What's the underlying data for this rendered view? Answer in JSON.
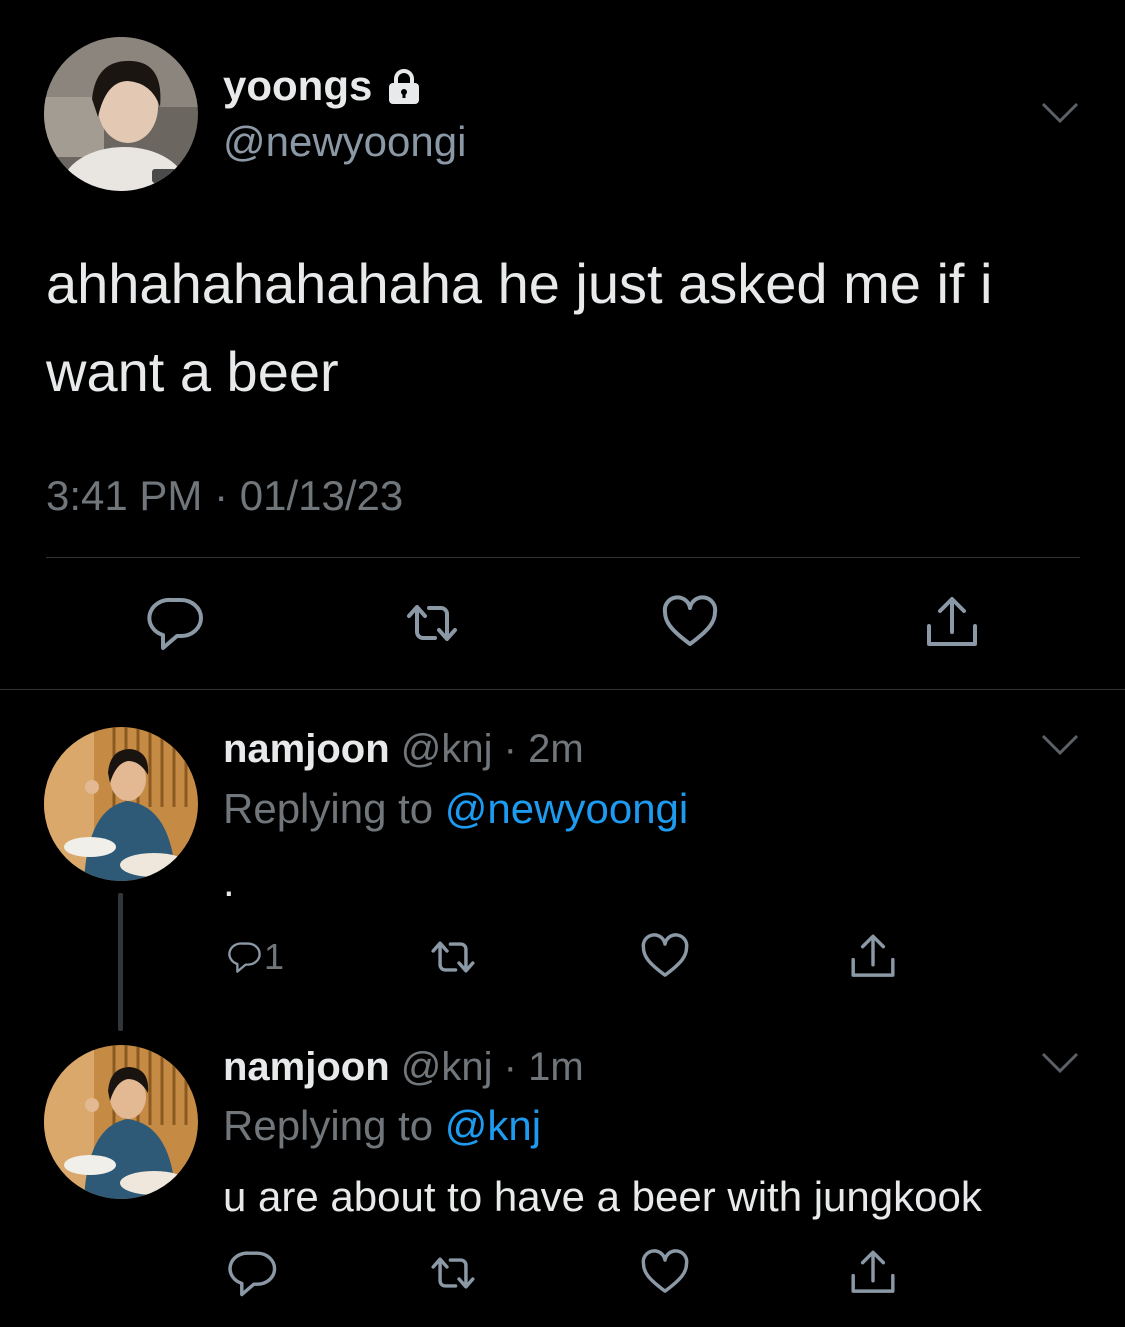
{
  "colors": {
    "background": "#000000",
    "text": "#e7e9ea",
    "secondary": "#71767b",
    "mention": "#1d9bf0",
    "divider": "#2f3336"
  },
  "main_tweet": {
    "display_name": "yoongs",
    "handle": "@newyoongi",
    "text": "ahhahahahahaha he just asked me if i want a beer",
    "timestamp": "3:41 PM · 01/13/23",
    "icons": [
      "lock-icon",
      "chevron-down-icon",
      "reply-icon",
      "retweet-icon",
      "like-icon",
      "share-icon"
    ]
  },
  "replies": [
    {
      "display_name": "namjoon",
      "handle": "@knj",
      "separator": " · ",
      "time": "2m",
      "replying_prefix": "Replying to ",
      "replying_to": "@newyoongi",
      "text": ".",
      "reply_count": "1"
    },
    {
      "display_name": "namjoon",
      "handle": "@knj",
      "separator": " · ",
      "time": "1m",
      "replying_prefix": "Replying to ",
      "replying_to": "@knj",
      "text": "u are about to have a beer with jungkook",
      "reply_count": ""
    }
  ]
}
